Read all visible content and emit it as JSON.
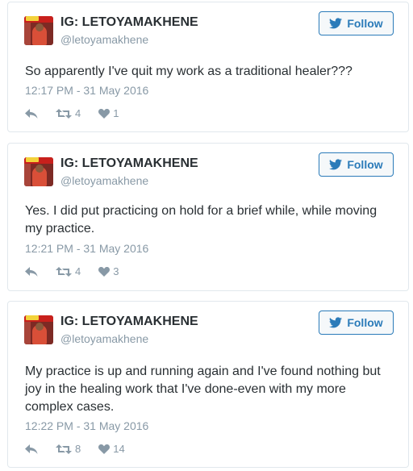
{
  "colors": {
    "accent": "#2b7bb9",
    "muted": "#8899a6",
    "text": "#292f33",
    "border": "#e1e8ed"
  },
  "follow_label": "Follow",
  "tweets": [
    {
      "name": "IG: LETOYAMAKHENE",
      "handle": "@letoyamakhene",
      "text": "So apparently I've quit my work as a traditional healer???",
      "time": "12:17 PM - 31 May 2016",
      "retweets": "4",
      "likes": "1"
    },
    {
      "name": "IG: LETOYAMAKHENE",
      "handle": "@letoyamakhene",
      "text": "Yes. I did put practicing on hold for a brief while, while moving my practice.",
      "time": "12:21 PM - 31 May 2016",
      "retweets": "4",
      "likes": "3"
    },
    {
      "name": "IG: LETOYAMAKHENE",
      "handle": "@letoyamakhene",
      "text": "My practice is up and running again and I've found nothing but joy in the healing work that I've done-even with my more complex cases.",
      "time": "12:22 PM - 31 May 2016",
      "retweets": "8",
      "likes": "14"
    }
  ]
}
